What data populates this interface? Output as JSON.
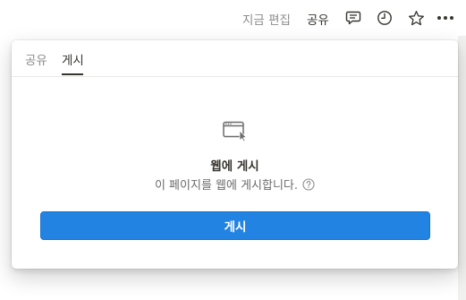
{
  "topbar": {
    "edited_label": "지금 편집",
    "share_label": "공유",
    "icons": [
      "comment-icon",
      "history-icon",
      "star-icon",
      "more-icon"
    ]
  },
  "popup": {
    "tabs": [
      {
        "label": "공유",
        "active": false
      },
      {
        "label": "게시",
        "active": true
      }
    ],
    "heading": "웹에 게시",
    "description": "이 페이지를 웹에 게시합니다.",
    "publish_button_label": "게시"
  },
  "colors": {
    "accent": "#2383e2",
    "text_primary": "#37352f",
    "text_muted": "#8c8c8c"
  }
}
